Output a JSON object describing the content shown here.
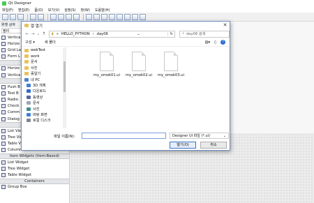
{
  "app": {
    "title": "Qt Designer"
  },
  "menubar": [
    "파일(F)",
    "편집(E)",
    "폼(O)",
    "보기(V)",
    "설정(S)",
    "창(W)",
    "도움말(H)"
  ],
  "widget_box": {
    "title": "위젯 상자",
    "filter": "필터",
    "items_top": [
      "Vertica",
      "Horizo",
      "Grid La",
      "Form L"
    ],
    "items_mid": [
      "Horizo",
      "Vertica",
      "Push B",
      "Tool B",
      "Radio",
      "Check",
      "Comm",
      "Dialog"
    ],
    "items_views": [
      "List View",
      "Tree View",
      "Table View",
      "Column View"
    ],
    "cat_item_widgets": "Item Widgets (Item-Based)",
    "items_widgets": [
      "List Widget",
      "Tree Widget",
      "Table Widget"
    ],
    "cat_containers": "Containers",
    "items_containers": [
      "Group Box"
    ]
  },
  "dialog": {
    "title": "열 열기",
    "breadcrumb": [
      "HELLO_PYTHON",
      "day06"
    ],
    "search_placeholder": "day06 검색",
    "organize": "구성 ▾",
    "new_folder": "새 폴더",
    "nav": [
      {
        "label": "webTest",
        "icon": "folder"
      },
      {
        "label": "work",
        "icon": "folder"
      },
      {
        "label": "문서",
        "icon": "folder"
      },
      {
        "label": "사진",
        "icon": "folder"
      },
      {
        "label": "홀일기",
        "icon": "folder"
      },
      {
        "label": "내 PC",
        "icon": "pc"
      },
      {
        "label": "3D 개체",
        "icon": "blue"
      },
      {
        "label": "다운로드",
        "icon": "dl"
      },
      {
        "label": "동영상",
        "icon": "mov"
      },
      {
        "label": "문서",
        "icon": "doc"
      },
      {
        "label": "사진",
        "icon": "img"
      },
      {
        "label": "바탕 화면",
        "icon": "blue"
      },
      {
        "label": "로컬 디스크",
        "icon": "drv"
      }
    ],
    "files": [
      "my_omok01.ui",
      "my_omok02.ui",
      "my_omok03.ui"
    ],
    "filename_label": "파일 이름(N):",
    "filename_value": "",
    "filetype": "Designer UI 파일 (*.ui)",
    "open_button": "열기(O)",
    "cancel_button": "취소"
  }
}
